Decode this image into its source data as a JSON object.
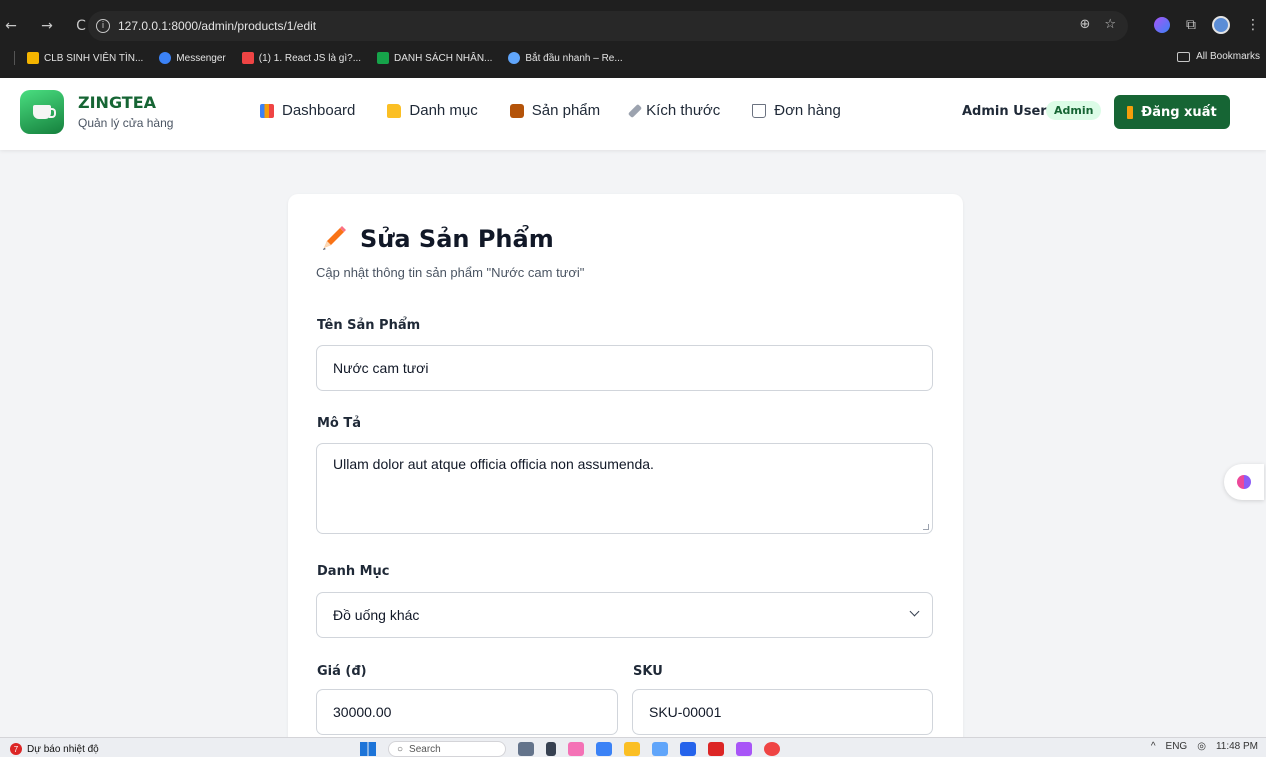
{
  "browser": {
    "url": "127.0.0.1:8000/admin/products/1/edit",
    "bookmarks": [
      {
        "label": "CLB SINH VIÊN TÌN...",
        "color": "#f4b400"
      },
      {
        "label": "Messenger",
        "color": "#3b82f6"
      },
      {
        "label": "(1) 1. React JS là gì?...",
        "color": "#ef4444"
      },
      {
        "label": "DANH SÁCH NHÂN...",
        "color": "#16a34a"
      },
      {
        "label": "Bắt đầu nhanh – Re...",
        "color": "#60a5fa"
      }
    ],
    "all_bookmarks": "All Bookmarks"
  },
  "header": {
    "brand": "ZINGTEA",
    "brand_sub": "Quản lý cửa hàng",
    "nav": [
      {
        "label": "Dashboard",
        "icon": "chart-icon"
      },
      {
        "label": "Danh mục",
        "icon": "folder-icon"
      },
      {
        "label": "Sản phẩm",
        "icon": "box-icon"
      },
      {
        "label": "Kích thước",
        "icon": "ruler-icon"
      },
      {
        "label": "Đơn hàng",
        "icon": "cart-icon"
      }
    ],
    "user_name": "Admin User",
    "user_role": "Admin",
    "logout_label": "Đăng xuất"
  },
  "form": {
    "title": "Sửa Sản Phẩm",
    "subtitle": "Cập nhật thông tin sản phẩm \"Nước cam tươi\"",
    "name_label": "Tên Sản Phẩm",
    "name_value": "Nước cam tươi",
    "desc_label": "Mô Tả",
    "desc_value": "Ullam dolor aut atque officia officia non assumenda.",
    "category_label": "Danh Mục",
    "category_value": "Đồ uống khác",
    "price_label": "Giá (đ)",
    "price_value": "30000.00",
    "sku_label": "SKU",
    "sku_value": "SKU-00001"
  },
  "taskbar": {
    "weather": "Dự báo nhiệt độ",
    "weather_badge": "7",
    "search_placeholder": "Search",
    "lang": "ENG",
    "time": "11:48 PM"
  }
}
